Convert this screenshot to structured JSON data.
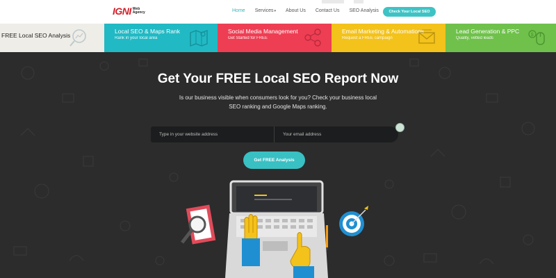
{
  "header": {
    "logo_main": "IGNI",
    "logo_sub": "Web Agency",
    "nav": [
      {
        "label": "Home",
        "active": true,
        "caret": false
      },
      {
        "label": "Services",
        "active": false,
        "caret": true
      },
      {
        "label": "About Us",
        "active": false,
        "caret": false
      },
      {
        "label": "Contact Us",
        "active": false,
        "caret": false
      },
      {
        "label": "SEO Analysis",
        "active": false,
        "caret": false
      }
    ],
    "cta_label": "Check Your Local SEO"
  },
  "tiles": [
    {
      "title": "FREE Local SEO Analysis",
      "subtitle": "",
      "color": "#eeede7",
      "icon": "magnifier-chart-icon"
    },
    {
      "title": "Local SEO & Maps Rank",
      "subtitle": "Rank in your local area",
      "color": "#21b9c4",
      "icon": "map-icon"
    },
    {
      "title": "Social Media Management",
      "subtitle": "Get Started for FREE",
      "color": "#ee3e53",
      "icon": "share-icon"
    },
    {
      "title": "Email Marketing & Automations",
      "subtitle": "Request a FREE campaign",
      "color": "#f3c21b",
      "icon": "envelope-icon"
    },
    {
      "title": "Lead Generation & PPC",
      "subtitle": "Quality, vetted leads",
      "color": "#6fc14b",
      "icon": "cursor-dollar-icon"
    }
  ],
  "hero": {
    "title": "Get Your FREE Local SEO Report Now",
    "description": "Is our business visible when consumers look for you? Check your business local SEO ranking and Google Maps ranking.",
    "url_placeholder": "Type in your website address",
    "email_placeholder": "Your email address",
    "button_label": "Get FREE Analysis"
  },
  "colors": {
    "accent": "#3ec3c5",
    "brand_red": "#d0202a",
    "hero_bg": "#2c2c2c"
  }
}
